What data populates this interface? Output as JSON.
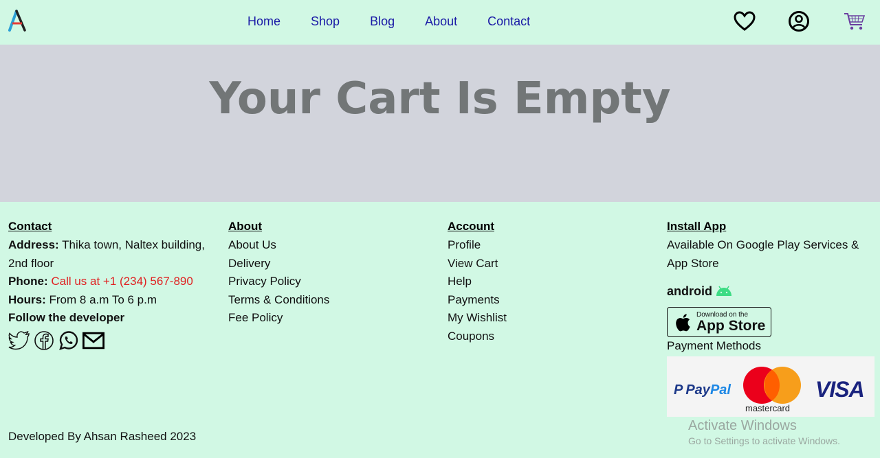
{
  "header": {
    "logo_icon": "logo-a-icon",
    "nav": [
      {
        "label": "Home"
      },
      {
        "label": "Shop"
      },
      {
        "label": "Blog"
      },
      {
        "label": "About"
      },
      {
        "label": "Contact"
      }
    ],
    "icons": [
      "heart-icon",
      "user-icon",
      "cart-icon"
    ]
  },
  "hero": {
    "title": "Your Cart Is Empty"
  },
  "footer": {
    "contact": {
      "heading": "Contact",
      "address_label": "Address:",
      "address_value": " Thika town, Naltex building, 2nd floor",
      "phone_label": "Phone:",
      "phone_value": " Call us at +1 (234) 567-890",
      "hours_label": "Hours:",
      "hours_value": " From 8 a.m To 6 p.m",
      "follow_label": "Follow the developer",
      "social_icons": [
        "twitter-icon",
        "facebook-icon",
        "whatsapp-icon",
        "mail-icon"
      ]
    },
    "about": {
      "heading": "About",
      "links": [
        "About Us",
        "Delivery",
        "Privacy Policy",
        "Terms & Conditions",
        "Fee Policy"
      ]
    },
    "account": {
      "heading": "Account",
      "links": [
        "Profile",
        "View Cart",
        "Help",
        "Payments",
        "My Wishlist",
        "Coupons"
      ]
    },
    "install": {
      "heading": "Install App",
      "text": "Available On Google Play Services & App Store",
      "android_label": "android",
      "appstore_small": "Download on the",
      "appstore_big": "App Store",
      "payment_label": "Payment Methods",
      "paypal_label_a": "Pay",
      "paypal_label_b": "Pal",
      "mastercard_label": "mastercard",
      "visa_label": "VISA"
    },
    "developed_by": "Developed By Ahsan Rasheed 2023"
  },
  "watermark": {
    "line1": "Activate Windows",
    "line2": "Go to Settings to activate Windows."
  },
  "colors": {
    "background": "#d1f8e4",
    "hero_bg": "#d2d4dc",
    "hero_text": "#727677",
    "nav_link": "#1a1aa6",
    "phone": "#e02020"
  }
}
